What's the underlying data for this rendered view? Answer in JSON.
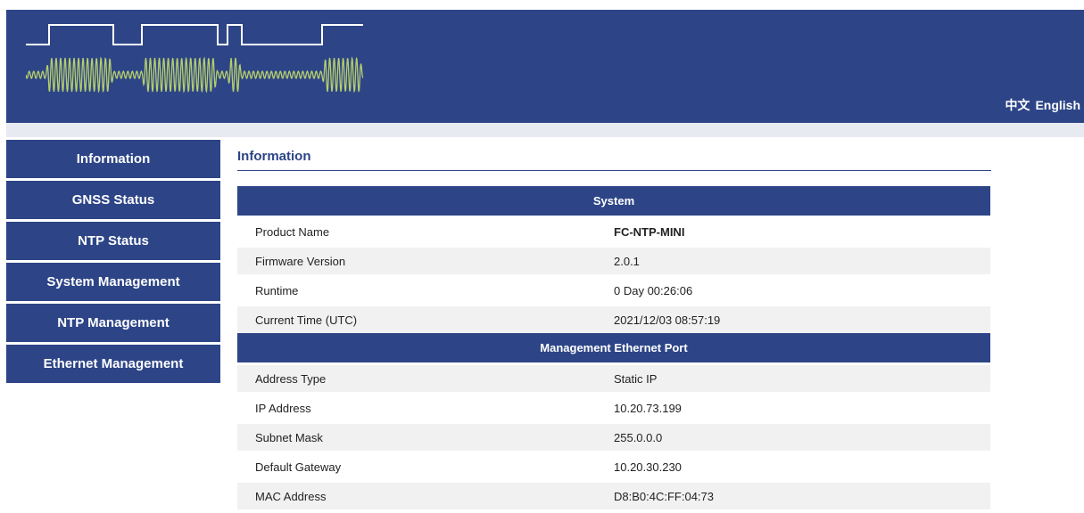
{
  "header": {
    "lang_chinese": "中文",
    "lang_english": "English"
  },
  "sidebar": {
    "items": [
      {
        "label": "Information"
      },
      {
        "label": "GNSS Status"
      },
      {
        "label": "NTP Status"
      },
      {
        "label": "System Management"
      },
      {
        "label": "NTP Management"
      },
      {
        "label": "Ethernet Management"
      }
    ]
  },
  "main": {
    "title": "Information",
    "system": {
      "heading": "System",
      "rows": [
        {
          "label": "Product Name",
          "value": "FC-NTP-MINI"
        },
        {
          "label": "Firmware Version",
          "value": "2.0.1"
        },
        {
          "label": "Runtime",
          "value": "0 Day 00:26:06"
        },
        {
          "label": "Current Time (UTC)",
          "value": "2021/12/03 08:57:19"
        }
      ]
    },
    "ethernet": {
      "heading": "Management Ethernet Port",
      "rows": [
        {
          "label": "Address Type",
          "value": "Static IP"
        },
        {
          "label": "IP Address",
          "value": "10.20.73.199"
        },
        {
          "label": "Subnet Mask",
          "value": "255.0.0.0"
        },
        {
          "label": "Default Gateway",
          "value": "10.20.30.230"
        },
        {
          "label": "MAC Address",
          "value": "D8:B0:4C:FF:04:73"
        }
      ]
    }
  },
  "colors": {
    "brand": "#2d4587",
    "subbar": "#e8eaf1",
    "row_shade": "#f1f1f1",
    "wave": "#b7cf6a"
  }
}
